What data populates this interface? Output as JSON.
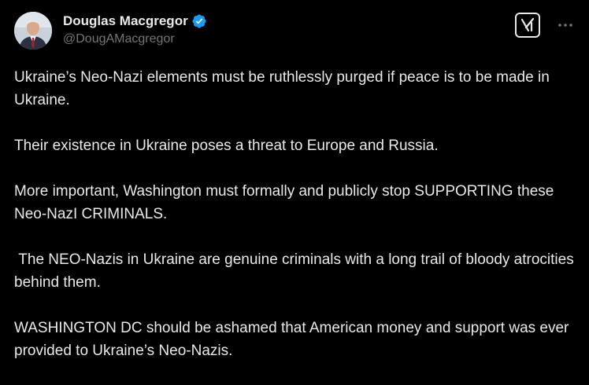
{
  "author": {
    "display_name": "Douglas Macgregor",
    "handle": "@DougAMacgregor",
    "verified_color": "#1d9bf0"
  },
  "icons": {
    "grok": "grok-icon",
    "more": "more-horizontal-icon",
    "verified": "verified-badge-icon"
  },
  "tweet": {
    "paragraphs": [
      "Ukraine’s Neo-Nazi elements must be ruthlessly purged if peace is to be made in Ukraine.",
      "Their existence in Ukraine poses a threat to Europe and Russia.",
      "More important, Washington must formally and publicly stop SUPPORTING these Neo-NazI CRIMINALS.",
      " The NEO-Nazis in Ukraine are genuine criminals with a long trail of bloody atrocities behind them.",
      "WASHINGTON DC should be ashamed that American money and support was ever provided to Ukraine’s Neo-Nazis."
    ]
  },
  "theme": {
    "background": "#000000",
    "text": "#e7e9ea",
    "secondary_text": "#71767b"
  }
}
